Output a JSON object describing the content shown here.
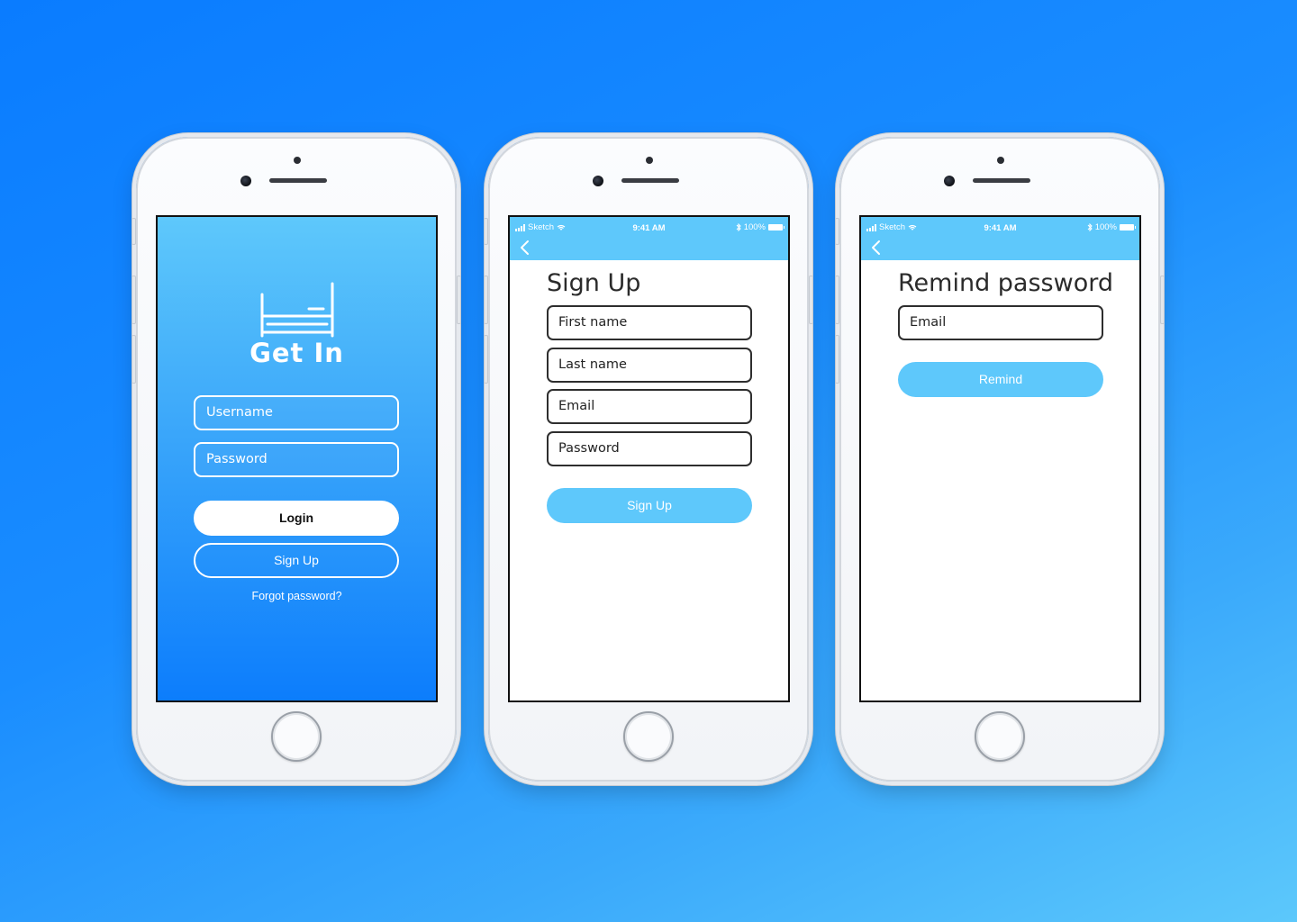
{
  "status_bar": {
    "carrier": "Sketch",
    "time": "9:41 AM",
    "battery": "100%"
  },
  "login": {
    "brand": "Get In",
    "username_placeholder": "Username",
    "password_placeholder": "Password",
    "login_label": "Login",
    "signup_label": "Sign Up",
    "forgot_label": "Forgot password?"
  },
  "signup": {
    "title": "Sign Up",
    "first_name_placeholder": "First name",
    "last_name_placeholder": "Last name",
    "email_placeholder": "Email",
    "password_placeholder": "Password",
    "submit_label": "Sign Up"
  },
  "remind": {
    "title": "Remind password",
    "email_placeholder": "Email",
    "submit_label": "Remind"
  },
  "colors": {
    "accent": "#5ec8fb",
    "gradient_top": "#5ec8fb",
    "gradient_bottom": "#0c7dfc",
    "background": "#1a8dff"
  }
}
